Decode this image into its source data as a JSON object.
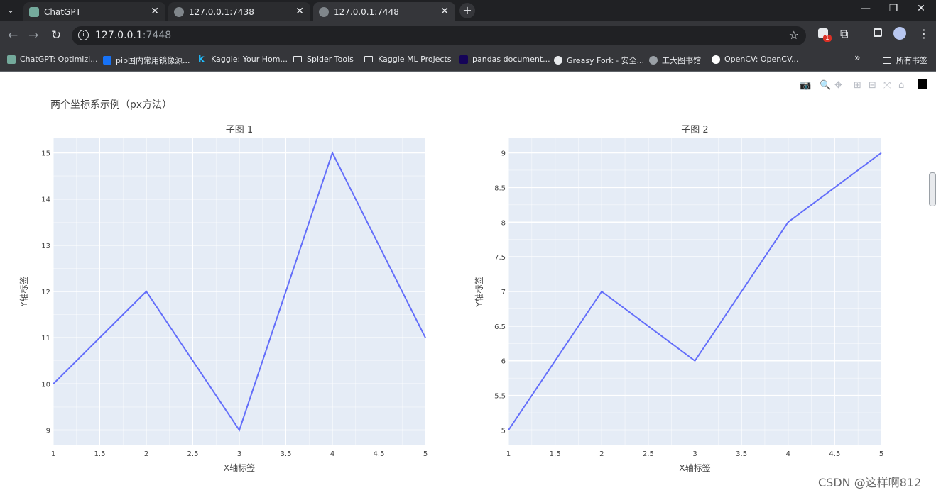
{
  "browser": {
    "tabs": [
      {
        "label": "ChatGPT",
        "active": false
      },
      {
        "label": "127.0.0.1:7438",
        "active": false
      },
      {
        "label": "127.0.0.1:7448",
        "active": true
      }
    ],
    "url_host": "127.0.0.1",
    "url_port": ":7448",
    "extension_badge": "1",
    "bookmarks": [
      {
        "label": "ChatGPT: Optimizi...",
        "icon": "chatgpt-icon"
      },
      {
        "label": "pip国内常用镜像源...",
        "icon": "zhihu-icon"
      },
      {
        "label": "Kaggle: Your Hom...",
        "icon": "kaggle-icon"
      },
      {
        "label": "Spider Tools",
        "icon": "folder-icon"
      },
      {
        "label": "Kaggle ML Projects",
        "icon": "folder-icon"
      },
      {
        "label": "pandas document...",
        "icon": "pandas-icon"
      },
      {
        "label": "Greasy Fork - 安全...",
        "icon": "greasyfork-icon"
      },
      {
        "label": "工大图书馆",
        "icon": "globe-icon"
      },
      {
        "label": "OpenCV: OpenCV...",
        "icon": "opencv-icon"
      }
    ],
    "all_bookmarks": "所有书签"
  },
  "page": {
    "title": "两个坐标系示例（px方法）",
    "watermark": "CSDN @这样啊812"
  },
  "colors": {
    "line": "#636efa",
    "plot_bg": "#e5ecf6",
    "grid": "#ffffff"
  },
  "chart_data": [
    {
      "type": "line",
      "title": "子图 1",
      "xlabel": "X轴标签",
      "ylabel": "Y轴标签",
      "x": [
        1,
        2,
        3,
        4,
        5
      ],
      "y": [
        10,
        12,
        9,
        15,
        11
      ],
      "xlim": [
        1,
        5
      ],
      "ylim": [
        8.67,
        15.33
      ],
      "xticks": [
        1,
        1.5,
        2,
        2.5,
        3,
        3.5,
        4,
        4.5,
        5
      ],
      "yticks": [
        9,
        10,
        11,
        12,
        13,
        14,
        15
      ],
      "grid": true
    },
    {
      "type": "line",
      "title": "子图 2",
      "xlabel": "X轴标签",
      "ylabel": "Y轴标签",
      "x": [
        1,
        2,
        3,
        4,
        5
      ],
      "y": [
        5,
        7,
        6,
        8,
        9
      ],
      "xlim": [
        1,
        5
      ],
      "ylim": [
        4.78,
        9.22
      ],
      "xticks": [
        1,
        1.5,
        2,
        2.5,
        3,
        3.5,
        4,
        4.5,
        5
      ],
      "yticks": [
        5,
        5.5,
        6,
        6.5,
        7,
        7.5,
        8,
        8.5,
        9
      ],
      "grid": true
    }
  ]
}
